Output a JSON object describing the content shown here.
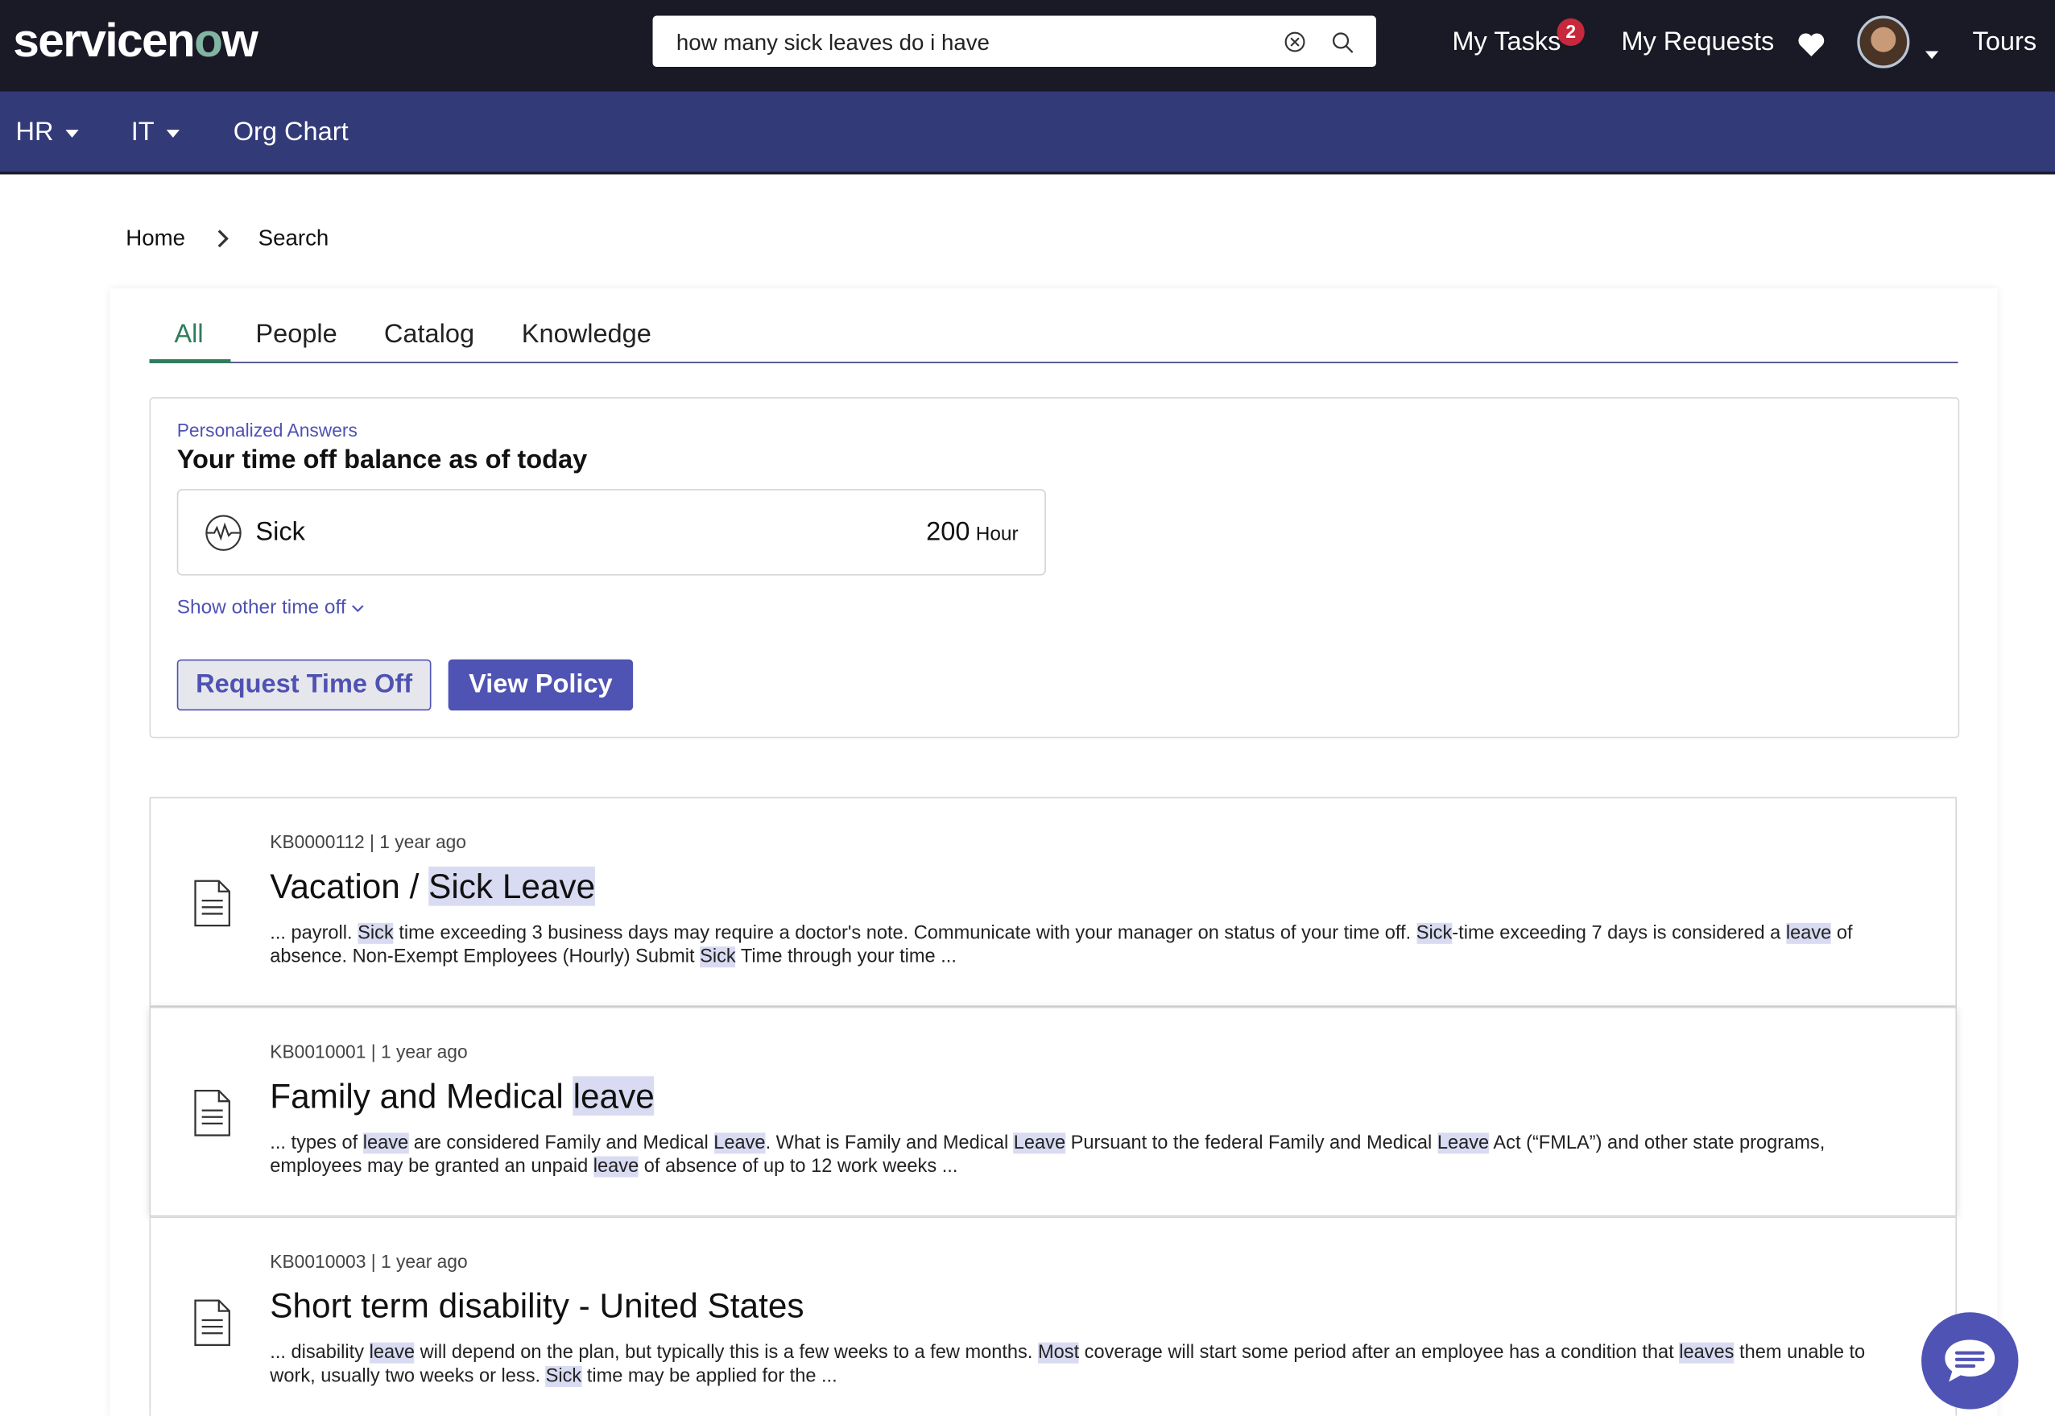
{
  "header": {
    "logo": {
      "before": "servicen",
      "o": "o",
      "after": "w"
    },
    "search_value": "how many sick leaves do i have",
    "my_tasks": "My Tasks",
    "tasks_badge": "2",
    "my_requests": "My Requests",
    "tours": "Tours"
  },
  "nav": {
    "items": [
      {
        "label": "HR"
      },
      {
        "label": "IT"
      },
      {
        "label": "Org Chart"
      }
    ]
  },
  "breadcrumb": {
    "home": "Home",
    "current": "Search"
  },
  "tabs": [
    {
      "label": "All",
      "selected": true
    },
    {
      "label": "People"
    },
    {
      "label": "Catalog"
    },
    {
      "label": "Knowledge"
    }
  ],
  "answer": {
    "eyebrow": "Personalized Answers",
    "title": "Your time off balance as of today",
    "balance": {
      "type": "Sick",
      "value": "200",
      "unit": "Hour"
    },
    "show_more": "Show other time off",
    "request_button": "Request Time Off",
    "policy_button": "View Policy"
  },
  "results": [
    {
      "meta": "KB0000112 | 1 year ago",
      "title": [
        {
          "t": "Vacation / "
        },
        {
          "t": "Sick Leave",
          "h": true
        }
      ],
      "snippet": [
        {
          "t": "... payroll. "
        },
        {
          "t": "Sick",
          "h": true
        },
        {
          "t": " time exceeding 3 business days may require a doctor's note. Communicate with your manager on status of your time off. "
        },
        {
          "t": "Sick",
          "h": true
        },
        {
          "t": "-time exceeding 7 days is considered a "
        },
        {
          "t": "leave",
          "h": true
        },
        {
          "t": " of absence. Non-Exempt Employees (Hourly) Submit "
        },
        {
          "t": "Sick",
          "h": true
        },
        {
          "t": " Time through your time ..."
        }
      ]
    },
    {
      "meta": "KB0010001 | 1 year ago",
      "title": [
        {
          "t": "Family and Medical "
        },
        {
          "t": "leave",
          "h": true
        }
      ],
      "snippet": [
        {
          "t": "... types of "
        },
        {
          "t": "leave",
          "h": true
        },
        {
          "t": " are considered Family and Medical "
        },
        {
          "t": "Leave",
          "h": true
        },
        {
          "t": ".   What is Family and Medical "
        },
        {
          "t": "Leave",
          "h": true
        },
        {
          "t": "   Pursuant to the federal Family and Medical "
        },
        {
          "t": "Leave",
          "h": true
        },
        {
          "t": " Act (“FMLA”) and other state programs, employees may be granted an unpaid "
        },
        {
          "t": "leave",
          "h": true
        },
        {
          "t": " of absence of up to 12 work weeks ..."
        }
      ]
    },
    {
      "meta": "KB0010003 | 1 year ago",
      "title": [
        {
          "t": "Short term disability - United States"
        }
      ],
      "snippet": [
        {
          "t": "... disability "
        },
        {
          "t": "leave",
          "h": true
        },
        {
          "t": " will depend on the plan, but typically this is a few weeks to a few months. "
        },
        {
          "t": "Most",
          "h": true
        },
        {
          "t": " coverage will start some period after an employee has a condition that "
        },
        {
          "t": "leaves",
          "h": true
        },
        {
          "t": " them unable to work, usually two weeks or less. "
        },
        {
          "t": "Sick",
          "h": true
        },
        {
          "t": " time may be applied for the ..."
        }
      ]
    }
  ],
  "colors": {
    "topbar": "#1a1a26",
    "navbar": "#333a78",
    "accent": "#4f54b4",
    "tab_selected": "#2e7d5b",
    "highlight": "#d9dbf2",
    "badge": "#c8283c"
  }
}
